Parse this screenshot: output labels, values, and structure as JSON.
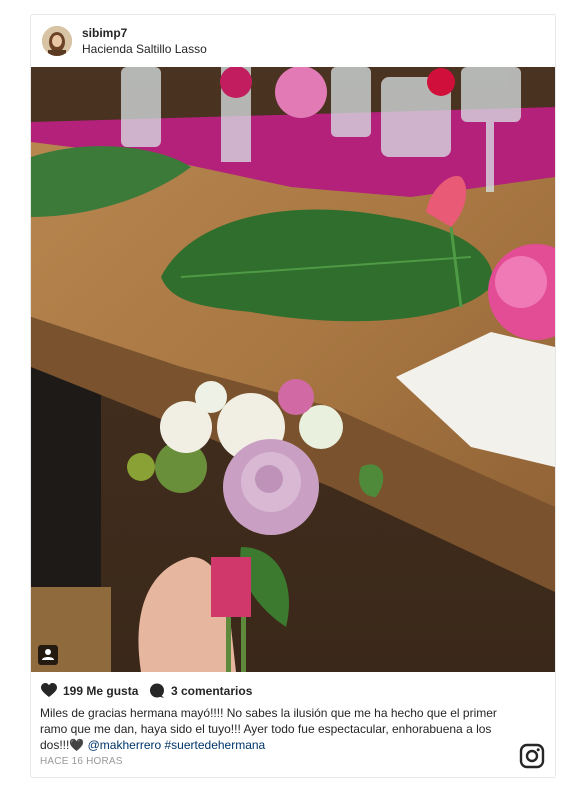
{
  "post": {
    "username": "sibimp7",
    "location": "Hacienda Saltillo Lasso",
    "likes_text": "199 Me gusta",
    "comments_text": "3 comentarios",
    "caption_text": "Miles de gracias hermana mayó!!!! No sabes la ilusión que me ha hecho que el primer ramo que me dan, haya sido el tuyo!!! Ayer todo fue espectacular, enhorabuena a los dos!!!🖤 ",
    "caption_tags": "@makherrero #suertedehermana",
    "timestamp": "HACE 16 HORAS"
  },
  "icons": {
    "like": "heart-icon",
    "comment": "comment-bubble-icon",
    "tagged_people": "person-tag-icon",
    "brand": "instagram-logo-icon"
  },
  "colors": {
    "text": "#262626",
    "link": "#003569",
    "muted": "#999999",
    "border": "#e6e6e6"
  }
}
